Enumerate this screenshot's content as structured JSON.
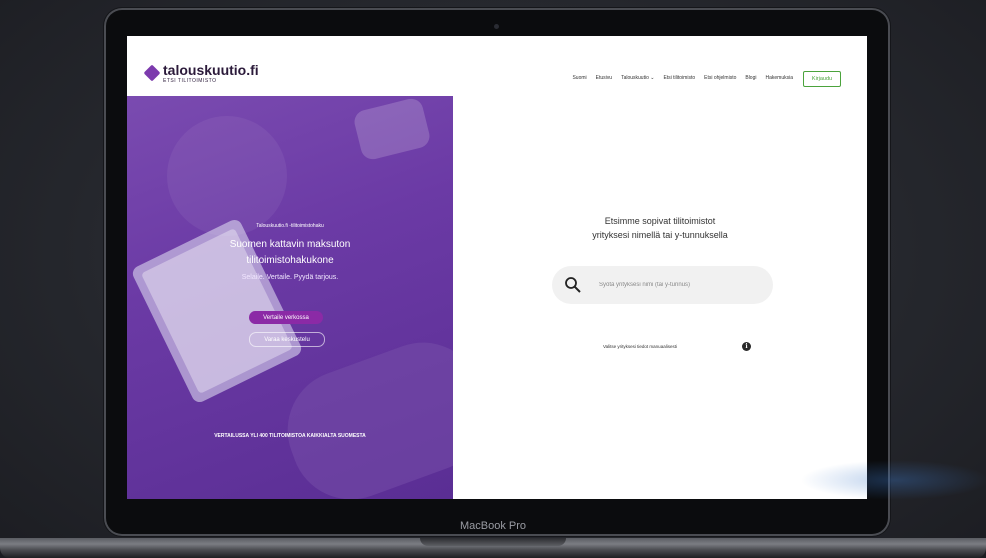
{
  "header": {
    "logo_text": "talouskuutio.fi",
    "logo_subtitle": "ETSI TILITOIMISTO",
    "nav": [
      "Suomi",
      "Etusivu",
      "Talouskuutio ⌄",
      "Etsi tilitoimisto",
      "Etsi ohjelmisto",
      "Blogi",
      "Hakemuksia"
    ],
    "login_label": "Kirjaudu"
  },
  "hero": {
    "eyebrow": "Talouskuutio.fi -tilitoimistohaku",
    "title_line1": "Suomen kattavin maksuton",
    "title_line2": "tilitoimistohakukone",
    "tagline": "Selaile. Vertaile. Pyydä tarjous.",
    "primary_button": "Vertaile verkossa",
    "secondary_button": "Varaa keskustelu",
    "footer": "VERTAILUSSA YLI 400 TILITOIMISTOA KAIKKIALTA SUOMESTA"
  },
  "search": {
    "heading_line1": "Etsimme sopivat tilitoimistot",
    "heading_line2": "yrityksesi nimellä tai y-tunnuksella",
    "placeholder": "Syötä yrityksesi nimi (tai y-tunnus)",
    "manual_link": "Valitse yrityksesi tiedot manuaalisesti",
    "info_symbol": "i"
  },
  "device": {
    "label": "MacBook Pro"
  },
  "colors": {
    "brand_purple": "#7c3aad",
    "button_purple": "#8b2aa6",
    "login_green": "#4ba33c"
  }
}
